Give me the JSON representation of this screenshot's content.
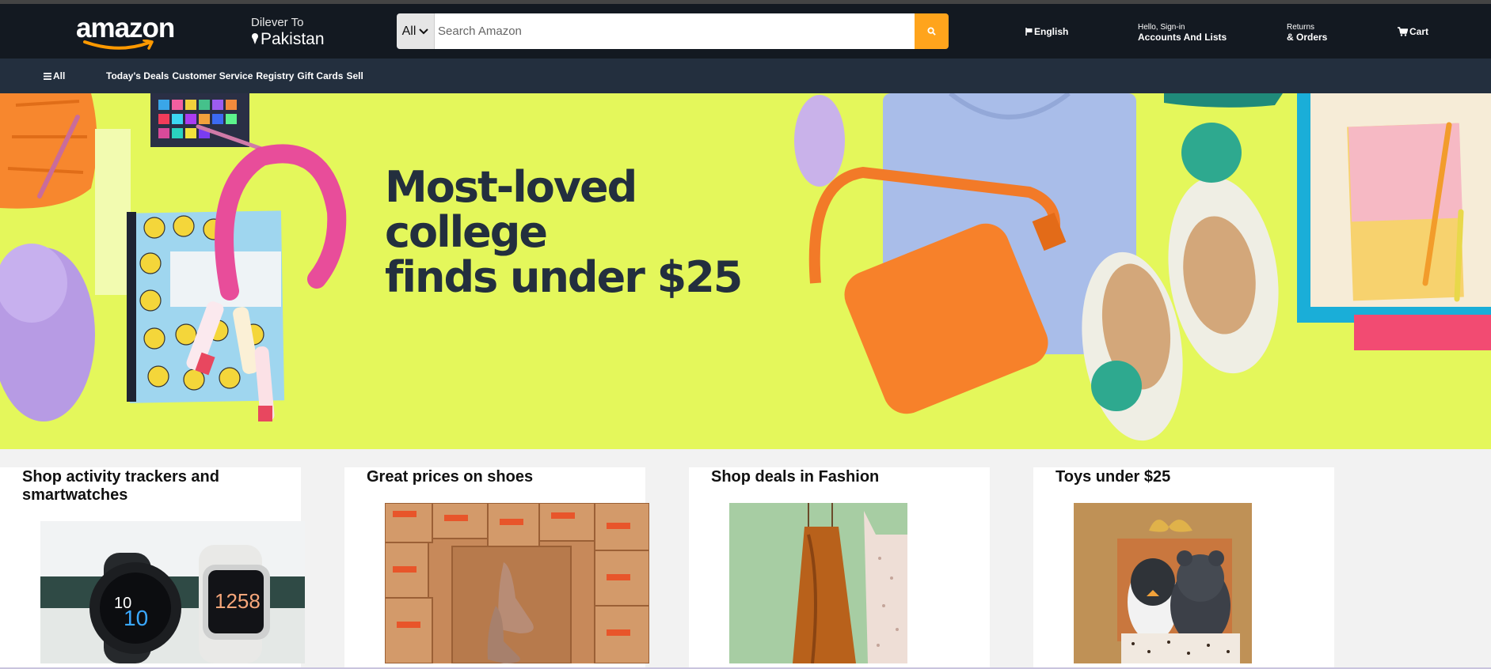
{
  "header": {
    "logo_text": "amazon",
    "deliver_to_label": "Dilever To",
    "deliver_to_location": "Pakistan",
    "search": {
      "category": "All",
      "placeholder": "Search Amazon"
    },
    "language": "English",
    "account_greeting": "Hello, Sign-in",
    "account_label": "Accounts And Lists",
    "returns_label": "Returns",
    "orders_label": "& Orders",
    "cart_label": "Cart"
  },
  "subnav": {
    "all_label": "All",
    "links": [
      "Today's Deals",
      "Customer Service",
      "Registry",
      "Gift Cards",
      "Sell"
    ]
  },
  "hero": {
    "title_line1": "Most-loved college",
    "title_line2": "finds under $25",
    "background_color": "#e4f75b"
  },
  "cards": [
    {
      "title": "Shop activity trackers and smartwatches"
    },
    {
      "title": "Great prices on shoes"
    },
    {
      "title": "Shop deals in Fashion"
    },
    {
      "title": "Toys under $25"
    }
  ],
  "colors": {
    "nav_bg": "#131921",
    "subnav_bg": "#232f3e",
    "search_button": "#ffa41c",
    "logo_smile": "#ff9900"
  }
}
